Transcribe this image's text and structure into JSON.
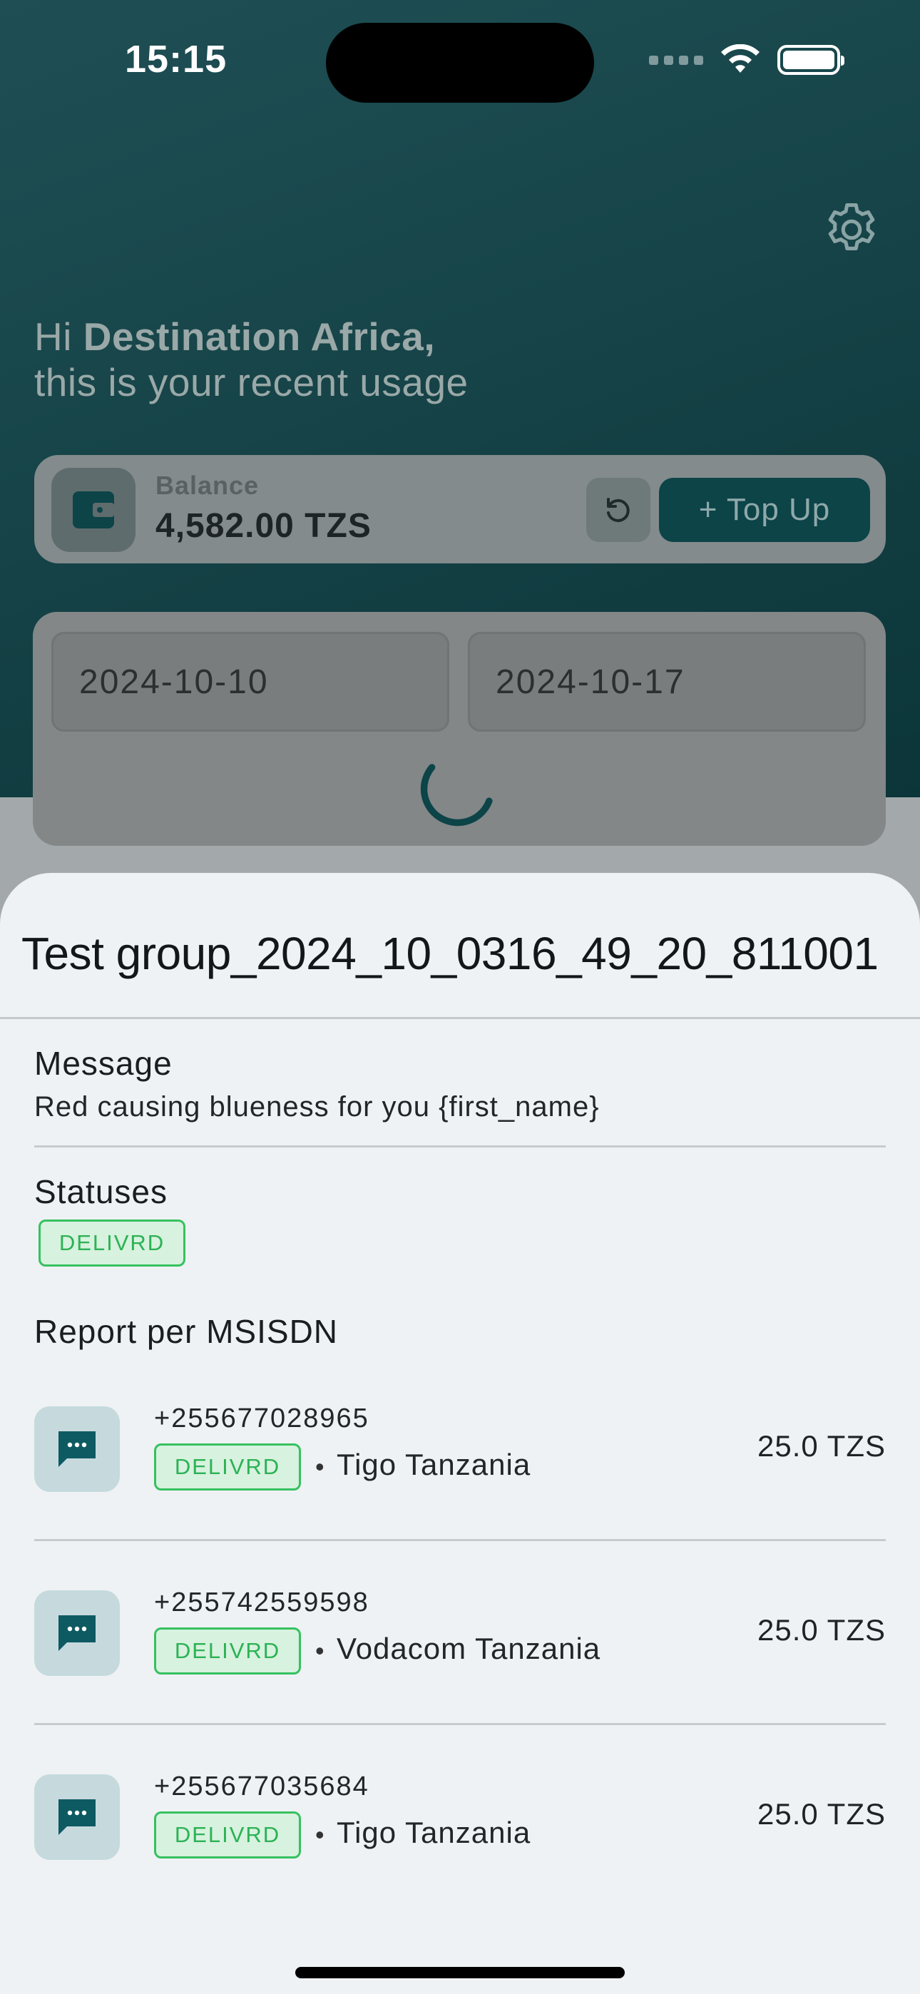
{
  "status_bar": {
    "time": "15:15"
  },
  "header": {
    "settings_icon": "gear-icon",
    "greeting_prefix": "Hi ",
    "user_name": "Destination Africa,",
    "subtitle": "this is your recent usage"
  },
  "balance": {
    "label": "Balance",
    "value": "4,582.00 TZS",
    "refresh_icon": "refresh-icon",
    "topup_label": "+ Top Up"
  },
  "filters": {
    "start_date": "2024-10-10",
    "end_date": "2024-10-17"
  },
  "sheet": {
    "title": "Test group_2024_10_0316_49_20_811001",
    "message_label": "Message",
    "message_text": "Red causing blueness for you {first_name}",
    "statuses_label": "Statuses",
    "statuses": [
      "DELIVRD"
    ],
    "report_label": "Report per MSISDN",
    "rows": [
      {
        "msisdn": "+255677028965",
        "status": "DELIVRD",
        "separator": "•",
        "network": "Tigo Tanzania",
        "amount": "25.0 TZS"
      },
      {
        "msisdn": "+255742559598",
        "status": "DELIVRD",
        "separator": "•",
        "network": "Vodacom Tanzania",
        "amount": "25.0 TZS"
      },
      {
        "msisdn": "+255677035684",
        "status": "DELIVRD",
        "separator": "•",
        "network": "Tigo Tanzania",
        "amount": "25.0 TZS"
      }
    ]
  },
  "colors": {
    "brand_dark": "#0c4448",
    "status_green": "#2cb255",
    "status_green_bg": "#d7f2de"
  }
}
